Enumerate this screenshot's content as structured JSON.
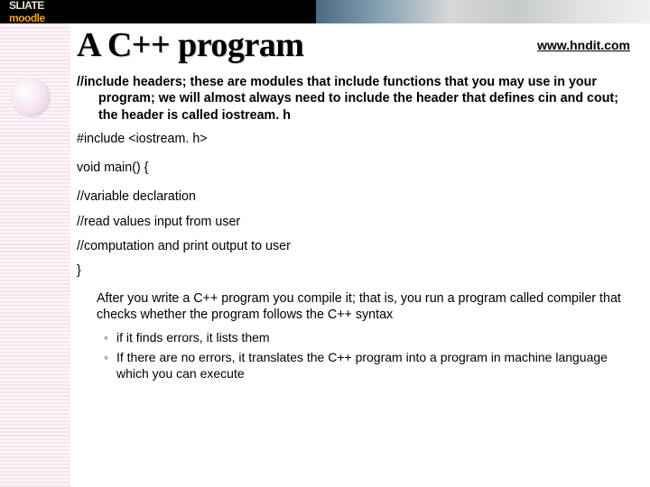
{
  "brand_part1": "SLIATE",
  "brand_part2": "moodle",
  "title": "A C++ program",
  "url": "www.hndit.com",
  "p_include": "//include headers; these are modules that include functions that you may use in your program; we will almost always need to include the header that  defines cin and cout; the header is called iostream. h",
  "p_include_hdr": "#include <iostream. h>",
  "p_main": "void main() {",
  "p_var": "//variable declaration",
  "p_read": "//read values input from user",
  "p_comp": "//computation  and print output to user",
  "p_close": "}",
  "p_after": "After you write a C++ program you compile it; that is, you run a program called compiler that checks whether the program follows the C++ syntax",
  "li1": "if it finds errors, it lists them",
  "li2": "If there are no errors, it translates the C++ program into a program in machine  language which you can execute"
}
